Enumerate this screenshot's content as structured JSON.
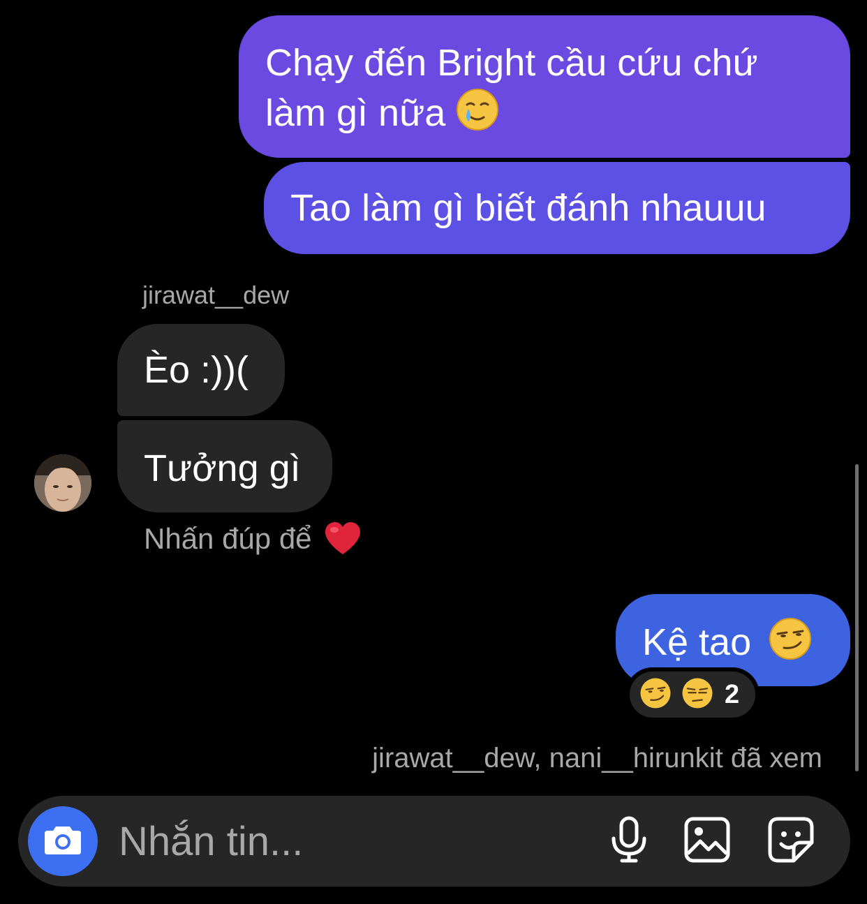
{
  "messages": {
    "sent_1": {
      "text": "Chạy đến Bright cầu cứu chứ làm gì nữa",
      "emoji": "🥲"
    },
    "sent_2": {
      "text": "Tao làm gì biết đánh nhauuu"
    },
    "sender_name": "jirawat__dew",
    "recv_1": {
      "text": "Èo :))("
    },
    "recv_2": {
      "text": "Tưởng gì"
    },
    "double_tap_hint": {
      "text": "Nhấn đúp để",
      "emoji": "❤️"
    },
    "sent_3": {
      "text": "Kệ tao",
      "emoji": "😏"
    },
    "reactions": {
      "emojis": [
        "😏",
        "😒"
      ],
      "count": "2"
    },
    "seen_by": "jirawat__dew, nani__hirunkit đã xem"
  },
  "composer": {
    "placeholder": "Nhắn tin..."
  },
  "colors": {
    "background": "#000000",
    "sent_bubble_purple": "#6b4ae2",
    "sent_bubble_indigo": "#5c51e4",
    "sent_bubble_blue": "#3d63e0",
    "received_bubble": "#262626",
    "secondary_text": "#a8a8a8",
    "camera_button": "#3d6ff2"
  },
  "icons": {
    "camera": "camera-icon",
    "mic": "microphone-icon",
    "gallery": "image-icon",
    "sticker": "sticker-icon"
  }
}
